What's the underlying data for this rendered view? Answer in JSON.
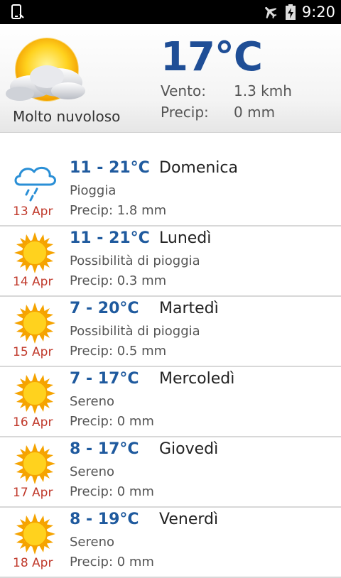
{
  "status_bar": {
    "time": "9:20",
    "icons": [
      "phone-icon",
      "airplane-icon",
      "battery-charging-icon"
    ]
  },
  "current": {
    "condition": "Molto nuvoloso",
    "temperature": "17°C",
    "wind_label": "Vento:",
    "wind_value": "1.3 kmh",
    "precip_label": "Precip:",
    "precip_value": "0 mm",
    "icon": "cloudy-sun-icon"
  },
  "forecast": [
    {
      "range": "11 - 21°C",
      "day": "Domenica",
      "desc": "Pioggia",
      "precip": "Precip: 1.8 mm",
      "date": "13 Apr",
      "icon": "rain-cloud-icon"
    },
    {
      "range": "11 - 21°C",
      "day": "Lunedì",
      "desc": "Possibilità di pioggia",
      "precip": "Precip: 0.3 mm",
      "date": "14 Apr",
      "icon": "sun-icon"
    },
    {
      "range": "7 - 20°C",
      "day": "Martedì",
      "desc": "Possibilità di pioggia",
      "precip": "Precip: 0.5 mm",
      "date": "15 Apr",
      "icon": "sun-icon"
    },
    {
      "range": "7 - 17°C",
      "day": "Mercoledì",
      "desc": "Sereno",
      "precip": "Precip: 0 mm",
      "date": "16 Apr",
      "icon": "sun-icon"
    },
    {
      "range": "8 - 17°C",
      "day": "Giovedì",
      "desc": "Sereno",
      "precip": "Precip: 0 mm",
      "date": "17 Apr",
      "icon": "sun-icon"
    },
    {
      "range": "8 - 19°C",
      "day": "Venerdì",
      "desc": "Sereno",
      "precip": "Precip: 0 mm",
      "date": "18 Apr",
      "icon": "sun-icon"
    }
  ],
  "colors": {
    "temp_blue": "#1f4e96",
    "date_red": "#c0392b",
    "sun_orange": "#f5a300",
    "sun_yellow": "#ffd21e"
  }
}
